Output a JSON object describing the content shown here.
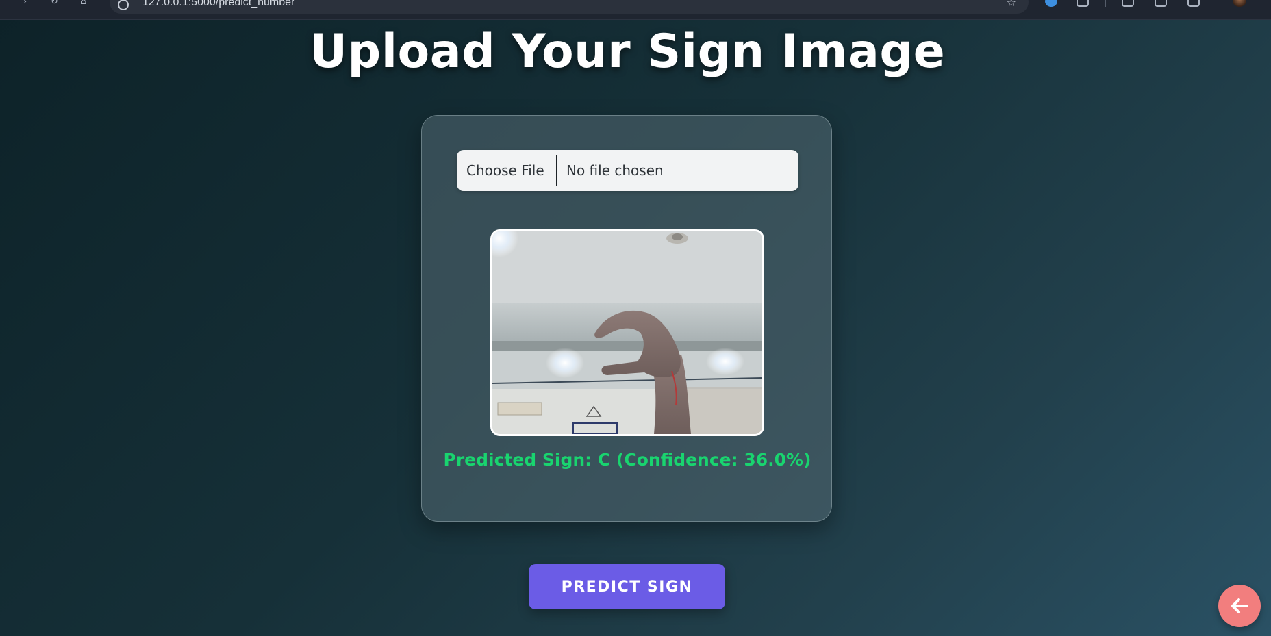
{
  "browser": {
    "url": "127.0.0.1:5000/predict_number"
  },
  "page": {
    "title": "Upload Your Sign Image"
  },
  "upload": {
    "choose_file_label": "Choose File",
    "file_status": "No file chosen"
  },
  "result": {
    "text": "Predicted Sign: C (Confidence: 36.0%)",
    "color": "#19d46f"
  },
  "actions": {
    "predict_label": "PREDICT SIGN",
    "predict_color": "#6b5ce6",
    "back_icon": "arrow-left-icon",
    "back_color": "#f27e7e"
  },
  "colors": {
    "background_start": "#0d2228",
    "background_end": "#2a5164"
  }
}
